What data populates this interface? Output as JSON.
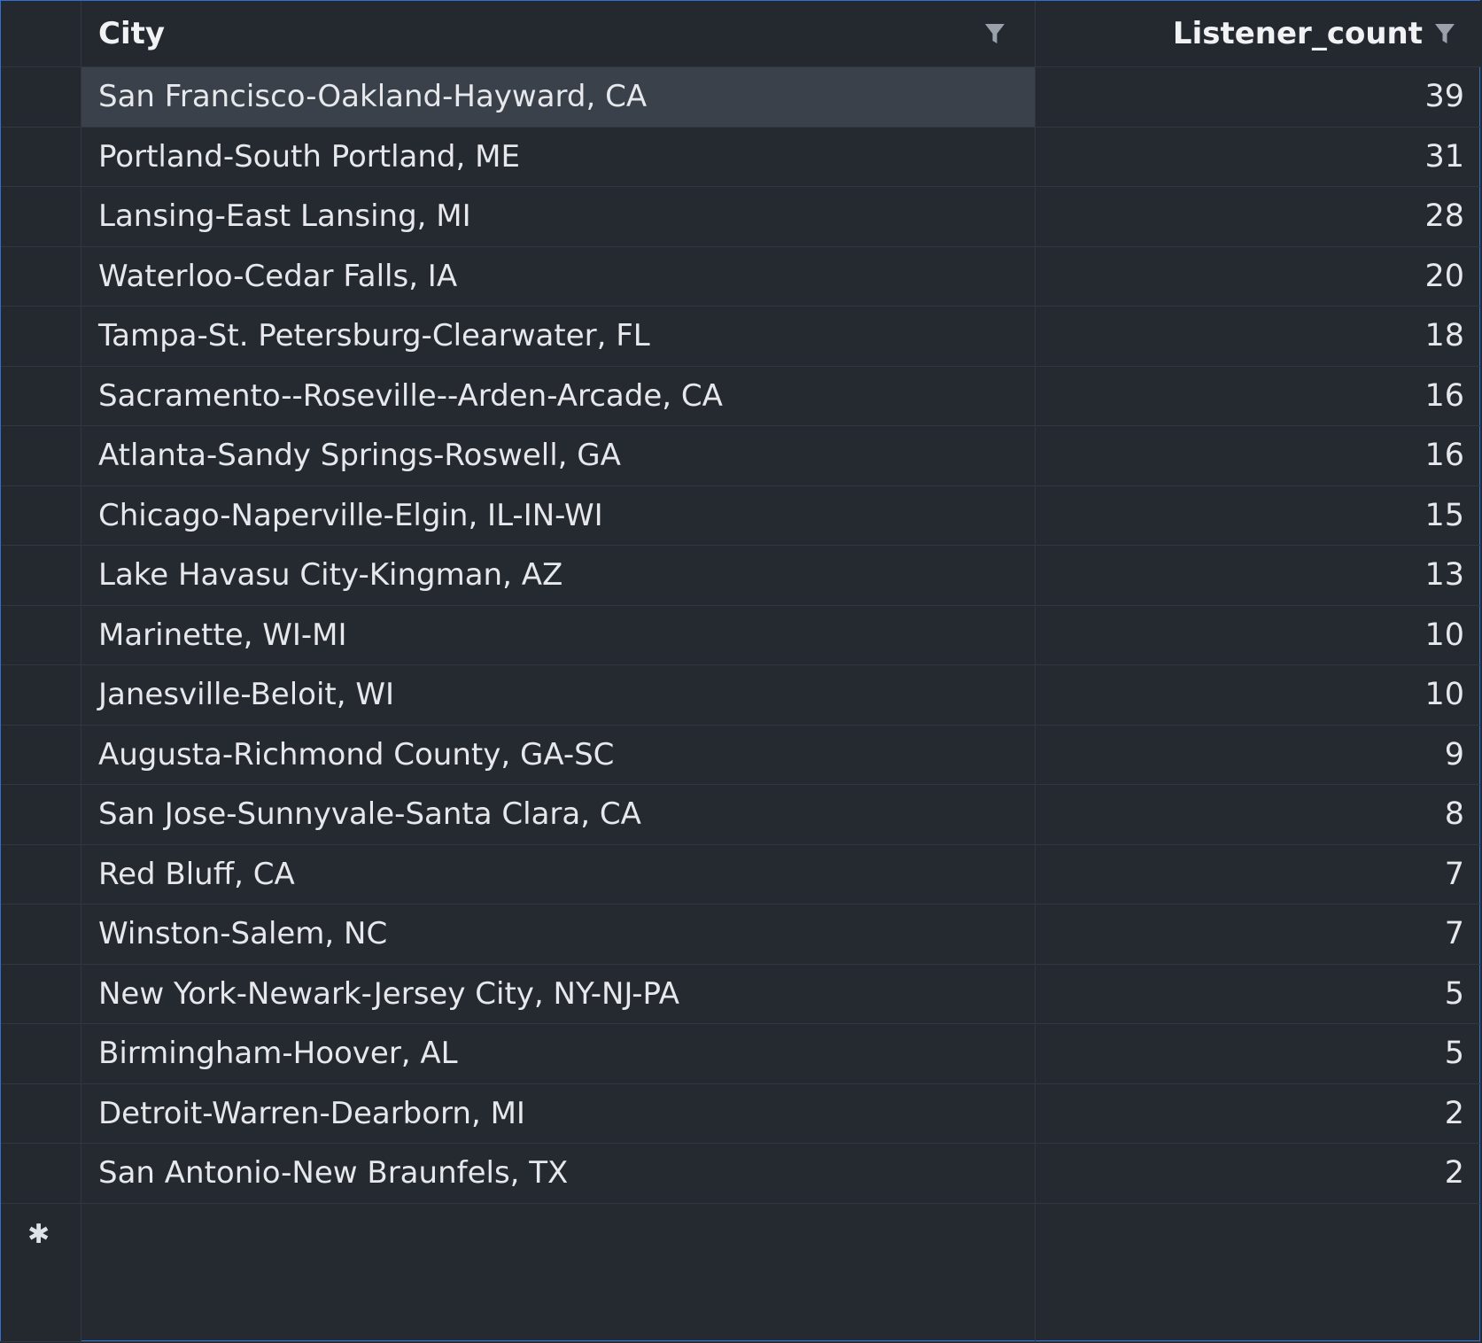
{
  "columns": {
    "city": "City",
    "listener_count": "Listener_count"
  },
  "rows": [
    {
      "city": "San Francisco-Oakland-Hayward, CA",
      "count": "39"
    },
    {
      "city": "Portland-South Portland, ME",
      "count": "31"
    },
    {
      "city": "Lansing-East Lansing, MI",
      "count": "28"
    },
    {
      "city": "Waterloo-Cedar Falls, IA",
      "count": "20"
    },
    {
      "city": "Tampa-St. Petersburg-Clearwater, FL",
      "count": "18"
    },
    {
      "city": "Sacramento--Roseville--Arden-Arcade, CA",
      "count": "16"
    },
    {
      "city": "Atlanta-Sandy Springs-Roswell, GA",
      "count": "16"
    },
    {
      "city": "Chicago-Naperville-Elgin, IL-IN-WI",
      "count": "15"
    },
    {
      "city": "Lake Havasu City-Kingman, AZ",
      "count": "13"
    },
    {
      "city": "Marinette, WI-MI",
      "count": "10"
    },
    {
      "city": "Janesville-Beloit, WI",
      "count": "10"
    },
    {
      "city": "Augusta-Richmond County, GA-SC",
      "count": "9"
    },
    {
      "city": "San Jose-Sunnyvale-Santa Clara, CA",
      "count": "8"
    },
    {
      "city": "Red Bluff, CA",
      "count": "7"
    },
    {
      "city": "Winston-Salem, NC",
      "count": "7"
    },
    {
      "city": "New York-Newark-Jersey City, NY-NJ-PA",
      "count": "5"
    },
    {
      "city": "Birmingham-Hoover, AL",
      "count": "5"
    },
    {
      "city": "Detroit-Warren-Dearborn, MI",
      "count": "2"
    },
    {
      "city": "San Antonio-New Braunfels, TX",
      "count": "2"
    }
  ],
  "new_row_marker": "✱",
  "icons": {
    "column_filter": "filter-icon",
    "new_row": "asterisk-icon"
  },
  "colors": {
    "background": "#252a31",
    "selected_cell": "#3a414b",
    "grid_lines": "#323841",
    "focus_border": "#2f6fd6",
    "text": "#e6e8eb"
  }
}
